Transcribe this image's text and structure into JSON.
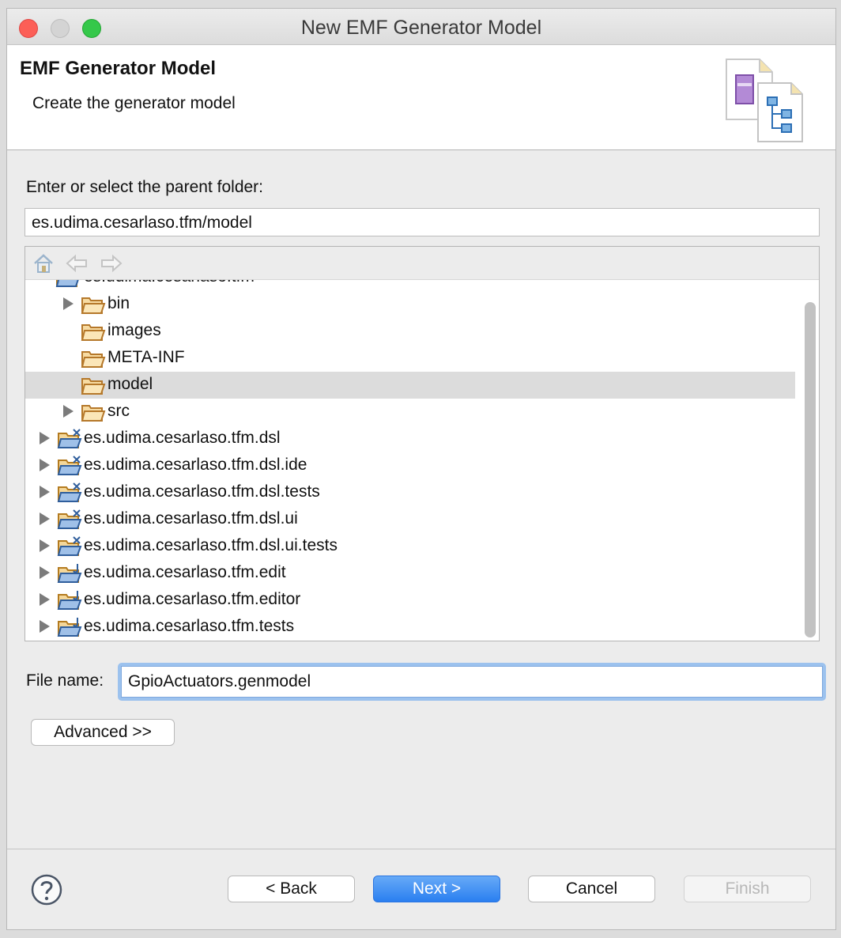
{
  "window": {
    "title": "New EMF Generator Model"
  },
  "banner": {
    "title": "EMF Generator Model",
    "description": "Create the generator model"
  },
  "folder": {
    "label": "Enter or select the parent folder:",
    "value": "es.udima.cesarlaso.tfm/model"
  },
  "tree": {
    "partial_top_label": "es.udima.cesarlaso.tfm",
    "rows": [
      {
        "label": "bin"
      },
      {
        "label": "images"
      },
      {
        "label": "META-INF"
      },
      {
        "label": "model"
      },
      {
        "label": "src"
      },
      {
        "label": "es.udima.cesarlaso.tfm.dsl"
      },
      {
        "label": "es.udima.cesarlaso.tfm.dsl.ide"
      },
      {
        "label": "es.udima.cesarlaso.tfm.dsl.tests"
      },
      {
        "label": "es.udima.cesarlaso.tfm.dsl.ui"
      },
      {
        "label": "es.udima.cesarlaso.tfm.dsl.ui.tests"
      },
      {
        "label": "es.udima.cesarlaso.tfm.edit"
      },
      {
        "label": "es.udima.cesarlaso.tfm.editor"
      },
      {
        "label": "es.udima.cesarlaso.tfm.tests"
      }
    ],
    "selected": "model"
  },
  "file": {
    "label": "File name:",
    "value": "GpioActuators.genmodel"
  },
  "buttons": {
    "advanced": "Advanced >>",
    "back": "< Back",
    "next": "Next >",
    "cancel": "Cancel",
    "finish": "Finish"
  },
  "icons": {
    "help": "help-icon",
    "home": "home-icon",
    "back": "back-arrow-icon",
    "forward": "forward-arrow-icon",
    "folder": "folder-icon",
    "xtext_project": "xtext-project-icon",
    "java_project": "java-project-icon"
  },
  "colors": {
    "primary_button": "#2a7ff0",
    "focus_ring": "#9cc2ee",
    "selection": "#dcdcdc"
  }
}
